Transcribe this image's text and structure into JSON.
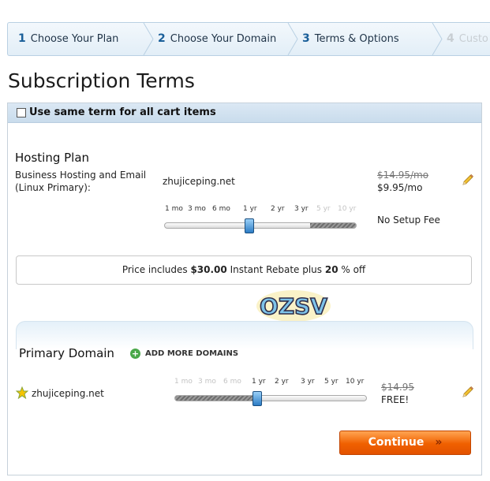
{
  "steps": [
    {
      "num": "1",
      "label": "Choose Your Plan"
    },
    {
      "num": "2",
      "label": "Choose Your Domain"
    },
    {
      "num": "3",
      "label": "Terms & Options"
    },
    {
      "num": "4",
      "label": "Custo"
    }
  ],
  "page_title": "Subscription Terms",
  "same_term_label": "Use same term for all cart items",
  "hosting": {
    "title": "Hosting Plan",
    "product_line1": "Business Hosting and Email",
    "product_line2": "(Linux Primary):",
    "domain": "zhujiceping.net",
    "old_price": "$14.95/mo",
    "new_price": "$9.95/mo",
    "setup_fee": "No Setup Fee",
    "terms": [
      "1 mo",
      "3 mo",
      "6 mo",
      "1 yr",
      "2 yr",
      "3 yr",
      "5 yr",
      "10 yr"
    ],
    "selected_term": "1 yr"
  },
  "rebate": {
    "prefix": "Price includes ",
    "amount": "$30.00",
    "middle": " Instant Rebate plus ",
    "percent": "20",
    "suffix": " % off"
  },
  "logo_text": "OZSV",
  "domain_section": {
    "title": "Primary Domain",
    "add_more": "ADD MORE DOMAINS",
    "domain": "zhujiceping.net",
    "old_price": "$14.95",
    "new_price": "FREE!",
    "terms": [
      "1 mo",
      "3 mo",
      "6 mo",
      "1 yr",
      "2 yr",
      "3 yr",
      "5 yr",
      "10 yr"
    ],
    "selected_term": "1 yr"
  },
  "continue_label": "Continue",
  "colors": {
    "accent_orange": "#f06000",
    "step_number_blue": "#1a5f99",
    "panel_header": "#c9dcec"
  }
}
